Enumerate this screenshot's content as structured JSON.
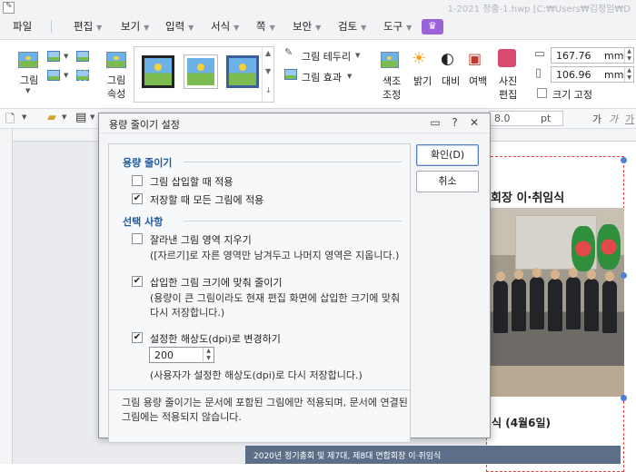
{
  "window": {
    "title": "1-2021 정출-1.hwp [C:₩Users₩김정임₩D"
  },
  "menu": {
    "items": [
      "파일",
      "편집",
      "보기",
      "입력",
      "서식",
      "쪽",
      "보안",
      "검토",
      "도구"
    ]
  },
  "ribbon": {
    "picture_label": "그림",
    "picture_props_label_1": "그림",
    "picture_props_label_2": "속성",
    "border_label": "그림 테두리",
    "effect_label": "그림 효과",
    "color_adjust_label_1": "색조",
    "color_adjust_label_2": "조정",
    "brightness_label": "밝기",
    "contrast_label": "대비",
    "margin_label": "여백",
    "photo_edit_label_1": "사진",
    "photo_edit_label_2": "편집",
    "width_value": "167.76",
    "height_value": "106.96",
    "size_unit": "mm",
    "fix_size_label": "크기 고정"
  },
  "toolbar2": {
    "font_size": "8.0",
    "font_unit": "pt",
    "style_glyphs": [
      "가",
      "가",
      "가"
    ]
  },
  "document": {
    "headline": "회장 이·취임식",
    "caption": "식 (4월6일)",
    "lower_banner": "2020년 정기총회 및 제7대, 제8대 연합회장 이·취임식"
  },
  "dialog": {
    "title": "용량 줄이기 설정",
    "help_icon": "help-icon",
    "close_icon": "close-icon",
    "section1": {
      "heading": "용량 줄이기",
      "options": [
        {
          "label": "그림 삽입할 때 적용",
          "checked": false
        },
        {
          "label": "저장할 때 모든 그림에 적용",
          "checked": true
        }
      ]
    },
    "section2": {
      "heading": "선택 사항",
      "crop_option": {
        "label": "잘라낸 그림 영역 지우기",
        "checked": false
      },
      "crop_note": "([자르기]로 자른 영역만 남겨두고 나머지 영역은 지웁니다.)",
      "shrink_option": {
        "label": "삽입한 그림 크기에 맞춰 줄이기",
        "checked": true
      },
      "shrink_note_1": "(용량이 큰 그림이라도 현재 편집 화면에 삽입한 크기에 맞춰",
      "shrink_note_2": "다시 저장합니다.)",
      "dpi_option": {
        "label": "설정한 해상도(dpi)로 변경하기",
        "checked": true
      },
      "dpi_value": "200",
      "dpi_note": "(사용자가 설정한 해상도(dpi)로 다시 저장합니다.)"
    },
    "footer_note_1": "그림 용량 줄이기는 문서에 포함된 그림에만 적용되며, 문서에 연결된",
    "footer_note_2": "그림에는 적용되지 않습니다.",
    "ok_button": "확인(D)",
    "cancel_button": "취소",
    "check_mark": "✔"
  }
}
